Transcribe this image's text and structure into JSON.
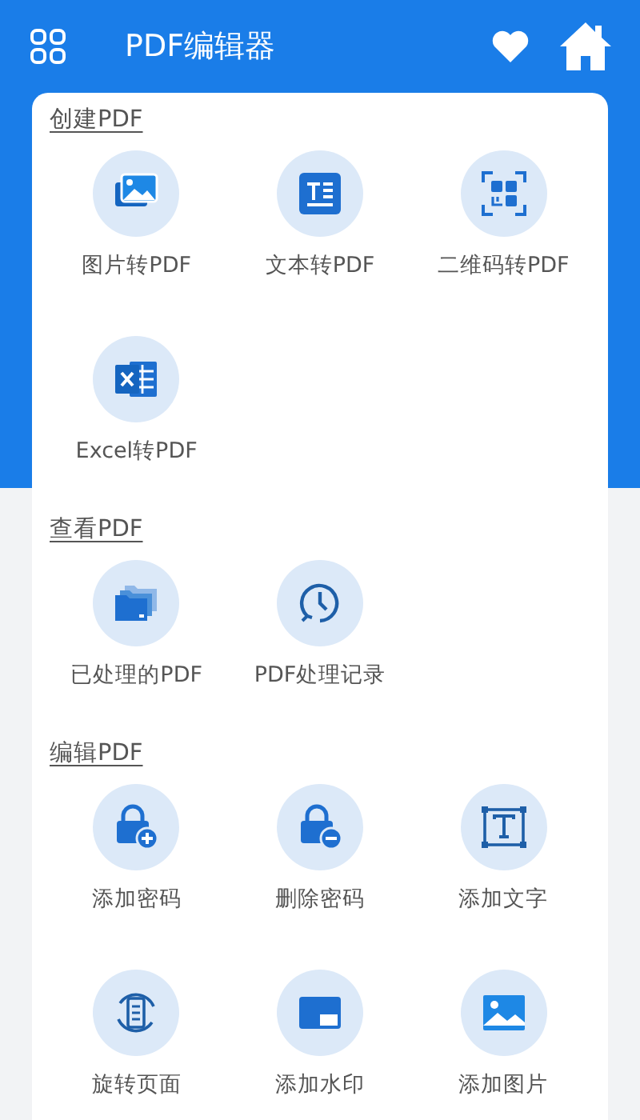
{
  "app_bar": {
    "title": "PDF编辑器"
  },
  "sections": [
    {
      "heading": "创建PDF",
      "items": [
        {
          "label": "图片转PDF"
        },
        {
          "label": "文本转PDF"
        },
        {
          "label": "二维码转PDF"
        },
        {
          "label": "Excel转PDF"
        }
      ]
    },
    {
      "heading": "查看PDF",
      "items": [
        {
          "label": "已处理的PDF"
        },
        {
          "label": "PDF处理记录"
        }
      ]
    },
    {
      "heading": "编辑PDF",
      "items": [
        {
          "label": "添加密码"
        },
        {
          "label": "删除密码"
        },
        {
          "label": "添加文字"
        },
        {
          "label": "旋转页面"
        },
        {
          "label": "添加水印"
        },
        {
          "label": "添加图片"
        }
      ]
    }
  ]
}
